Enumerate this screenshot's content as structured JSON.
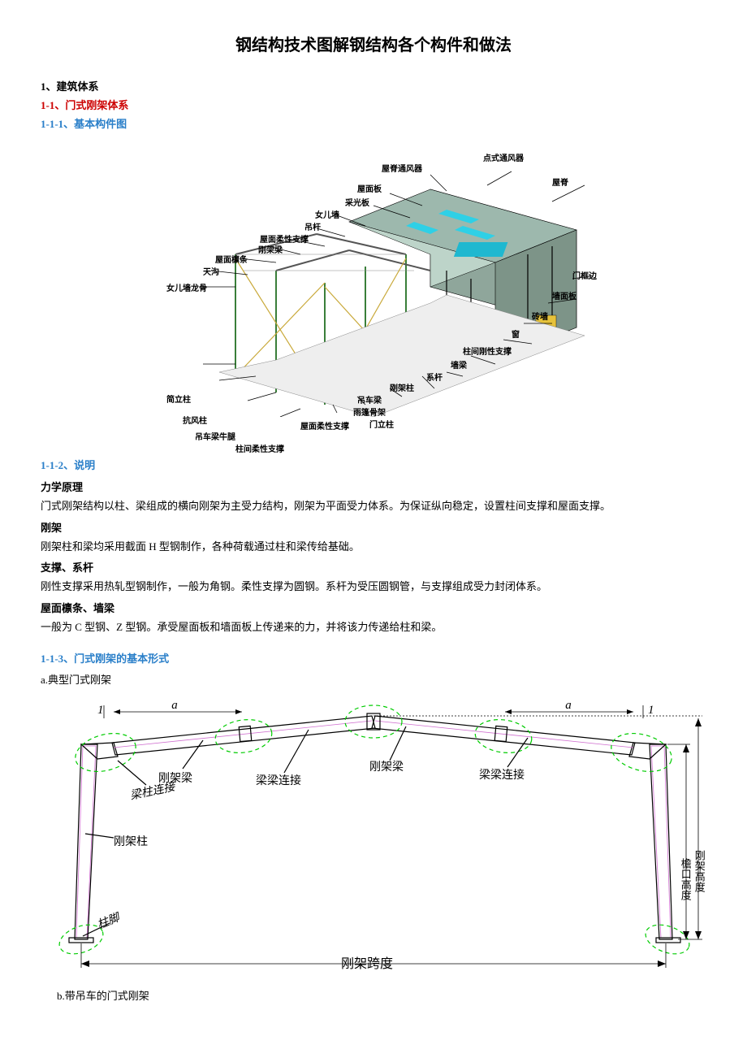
{
  "title": "钢结构技术图解钢结构各个构件和做法",
  "sec1": "1、建筑体系",
  "sec1_1": "1-1、门式刚架体系",
  "sec1_1_1": "1-1-1、基本构件图",
  "diagram1_labels": {
    "dianshi_tongfeng": "点式通风器",
    "wuji_tongfeng": "屋脊通风器",
    "wuji": "屋脊",
    "wumianban": "屋面板",
    "caiguanban": "采光板",
    "nverqiang": "女儿墙",
    "diaogan": "吊杆",
    "wumian_rouxing": "屋面柔性支撑",
    "gangjialing": "刚架梁",
    "wumian_linchao": "屋面檩条",
    "tiangou": "天沟",
    "nverqiang_longgu": "女儿墙龙骨",
    "menkuangbian": "门框边",
    "qiangmianban": "墙面板",
    "zhuanqiang": "砖墙",
    "chuang": "窗",
    "zhuijian_gangxing": "柱间刚性支撑",
    "qianglilin": "墙梁",
    "xigang": "系杆",
    "gangjiazhu": "刚架柱",
    "diaocheliang": "吊车梁",
    "yupengguliang": "雨篷骨架",
    "menlizhu": "门立柱",
    "wumian_rouxing2": "屋面柔性支撑",
    "zhuijian_rouxing": "柱间柔性支撑",
    "diaoche_niutu": "吊车梁牛腿",
    "kangfengzhu": "抗风柱",
    "jianlizhu": "简立柱"
  },
  "sec1_1_2": "1-1-2、说明",
  "lixue_h": "力学原理",
  "lixue_p": "门式刚架结构以柱、梁组成的横向刚架为主受力结构，刚架为平面受力体系。为保证纵向稳定，设置柱间支撑和屋面支撑。",
  "gangjia_h": "刚架",
  "gangjia_p": "刚架柱和梁均采用截面 H 型钢制作，各种荷载通过柱和梁传给基础。",
  "zhicheng_h": "支撑、系杆",
  "zhicheng_p": "刚性支撑采用热轧型钢制作，一般为角钢。柔性支撑为圆钢。系杆为受压圆钢管，与支撑组成受力封闭体系。",
  "wumian_h": "屋面檩条、墙梁",
  "wumian_p": "一般为 C 型钢、Z 型钢。承受屋面板和墙面板上传递来的力，并将该力传递给柱和梁。",
  "sec1_1_3": "1-1-3、门式刚架的基本形式",
  "form_a": "a.典型门式刚架",
  "diagram2_labels": {
    "gangjialing1": "刚架梁",
    "liangliang_lianjie": "梁梁连接",
    "gangjialing2": "刚架梁",
    "liangliang_lianjie2": "梁梁连接",
    "liangzhu_lianjie": "梁柱连接",
    "gangjiazhu": "刚架柱",
    "zhujiao": "柱脚",
    "gangjia_kuadu": "刚架跨度",
    "yankou_gaodu": "檐口高度",
    "gangjia_gaodu": "刚架高度",
    "a1": "a",
    "a2": "a",
    "one1": "1",
    "one2": "1"
  },
  "form_b": "b.带吊车的门式刚架"
}
